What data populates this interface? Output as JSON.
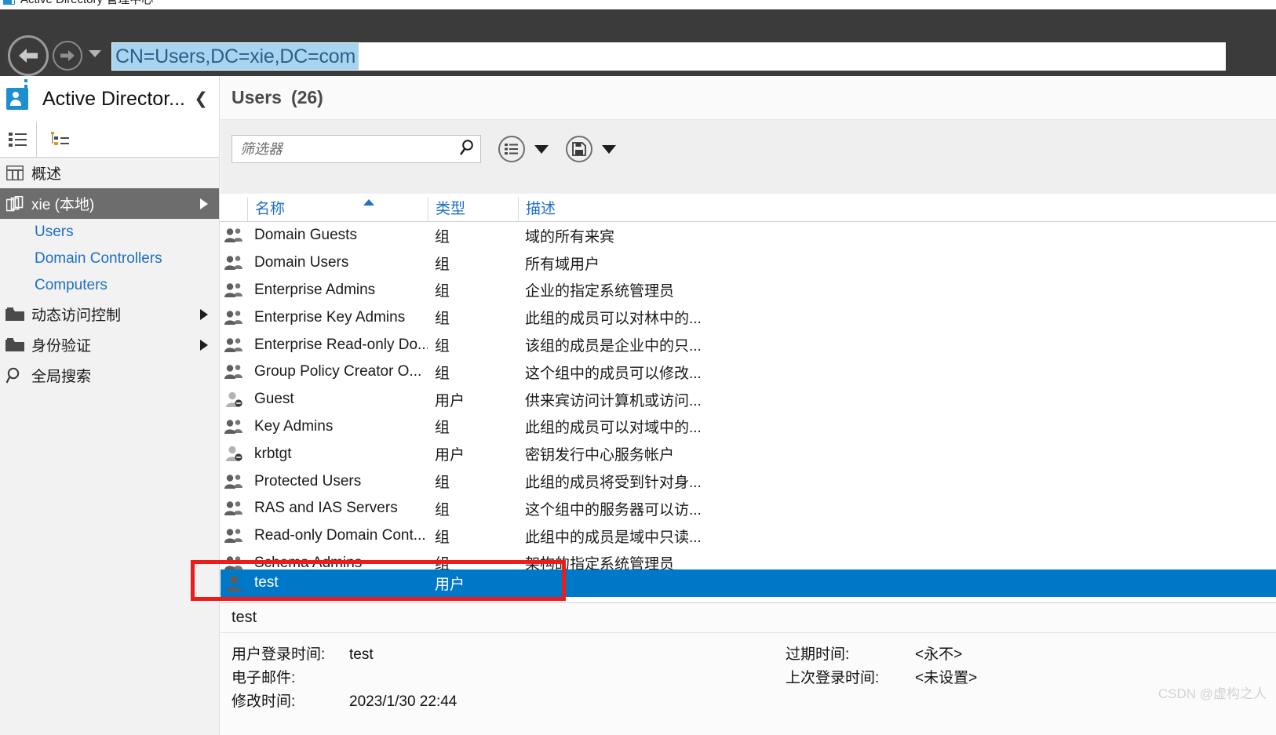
{
  "window": {
    "title": "Active Directory 管理中心",
    "logo_icon": "ad-app-icon"
  },
  "navbar": {
    "back_icon": "back-arrow-icon",
    "forward_icon": "forward-arrow-icon",
    "history_dropdown_icon": "chevron-down-icon",
    "address_value": "CN=Users,DC=xie,DC=com"
  },
  "sidebar": {
    "header_title": "Active Director...",
    "collapse_icon": "chevron-left-icon",
    "tabs": [
      {
        "name": "list-view-tab",
        "icon": "list-view-icon"
      },
      {
        "name": "tree-view-tab",
        "icon": "tree-view-icon"
      }
    ],
    "items": [
      {
        "label": "概述",
        "icon": "overview-icon",
        "type": "item",
        "selected": false,
        "expandable": false
      },
      {
        "label": "xie (本地)",
        "icon": "domain-icon",
        "type": "item",
        "selected": true,
        "expandable": true
      },
      {
        "label": "Users",
        "type": "child"
      },
      {
        "label": "Domain Controllers",
        "type": "child"
      },
      {
        "label": "Computers",
        "type": "child"
      },
      {
        "label": "动态访问控制",
        "icon": "folder-icon",
        "type": "item",
        "selected": false,
        "expandable": true
      },
      {
        "label": "身份验证",
        "icon": "folder-icon",
        "type": "item",
        "selected": false,
        "expandable": true
      },
      {
        "label": "全局搜索",
        "icon": "search-icon",
        "type": "item",
        "selected": false,
        "expandable": false
      }
    ]
  },
  "main": {
    "title": "Users",
    "count": "(26)",
    "filter": {
      "placeholder": "筛选器",
      "value": "",
      "search_icon": "search-icon"
    },
    "toolbar_buttons": [
      {
        "name": "view-options-button",
        "icon": "list-options-icon",
        "has_caret": true
      },
      {
        "name": "save-query-button",
        "icon": "save-disk-icon",
        "has_caret": true
      }
    ],
    "columns": [
      {
        "key": "name",
        "label": "名称",
        "sorted": true,
        "sort_dir": "asc"
      },
      {
        "key": "type",
        "label": "类型"
      },
      {
        "key": "description",
        "label": "描述"
      }
    ],
    "rows": [
      {
        "icon": "group-icon",
        "name": "Domain Guests",
        "type": "组",
        "description": "域的所有来宾",
        "selected": false
      },
      {
        "icon": "group-icon",
        "name": "Domain Users",
        "type": "组",
        "description": "所有域用户",
        "selected": false
      },
      {
        "icon": "group-icon",
        "name": "Enterprise Admins",
        "type": "组",
        "description": "企业的指定系统管理员",
        "selected": false
      },
      {
        "icon": "group-icon",
        "name": "Enterprise Key Admins",
        "type": "组",
        "description": "此组的成员可以对林中的...",
        "selected": false
      },
      {
        "icon": "group-icon",
        "name": "Enterprise Read-only Do...",
        "type": "组",
        "description": "该组的成员是企业中的只...",
        "selected": false
      },
      {
        "icon": "group-icon",
        "name": "Group Policy Creator O...",
        "type": "组",
        "description": "这个组中的成员可以修改...",
        "selected": false
      },
      {
        "icon": "user-disabled-icon",
        "name": "Guest",
        "type": "用户",
        "description": "供来宾访问计算机或访问...",
        "selected": false
      },
      {
        "icon": "group-icon",
        "name": "Key Admins",
        "type": "组",
        "description": "此组的成员可以对域中的...",
        "selected": false
      },
      {
        "icon": "user-disabled-icon",
        "name": "krbtgt",
        "type": "用户",
        "description": "密钥发行中心服务帐户",
        "selected": false
      },
      {
        "icon": "group-icon",
        "name": "Protected Users",
        "type": "组",
        "description": "此组的成员将受到针对身...",
        "selected": false
      },
      {
        "icon": "group-icon",
        "name": "RAS and IAS Servers",
        "type": "组",
        "description": "这个组中的服务器可以访...",
        "selected": false
      },
      {
        "icon": "group-icon",
        "name": "Read-only Domain Cont...",
        "type": "组",
        "description": "此组中的成员是域中只读...",
        "selected": false
      },
      {
        "icon": "group-icon",
        "name": "Schema Admins",
        "type": "组",
        "description": "架构的指定系统管理员",
        "selected": false
      },
      {
        "icon": "user-icon",
        "name": "test",
        "type": "用户",
        "description": "",
        "selected": true
      }
    ]
  },
  "detail": {
    "title": "test",
    "left_fields": [
      {
        "label": "用户登录时间:",
        "value": "test"
      },
      {
        "label": "电子邮件:",
        "value": ""
      },
      {
        "label": "修改时间:",
        "value": "2023/1/30 22:44"
      }
    ],
    "right_fields": [
      {
        "label": "过期时间:",
        "value": "<永不>"
      },
      {
        "label": "上次登录时间:",
        "value": "<未设置>"
      }
    ]
  },
  "watermark": "CSDN @虚构之人",
  "colors": {
    "accent_blue": "#1f6fc4",
    "selection_blue": "#0078c8",
    "nav_dark": "#3b3b3b",
    "annotation_red": "#ee1b1b",
    "address_highlight": "#a8d4f0"
  }
}
